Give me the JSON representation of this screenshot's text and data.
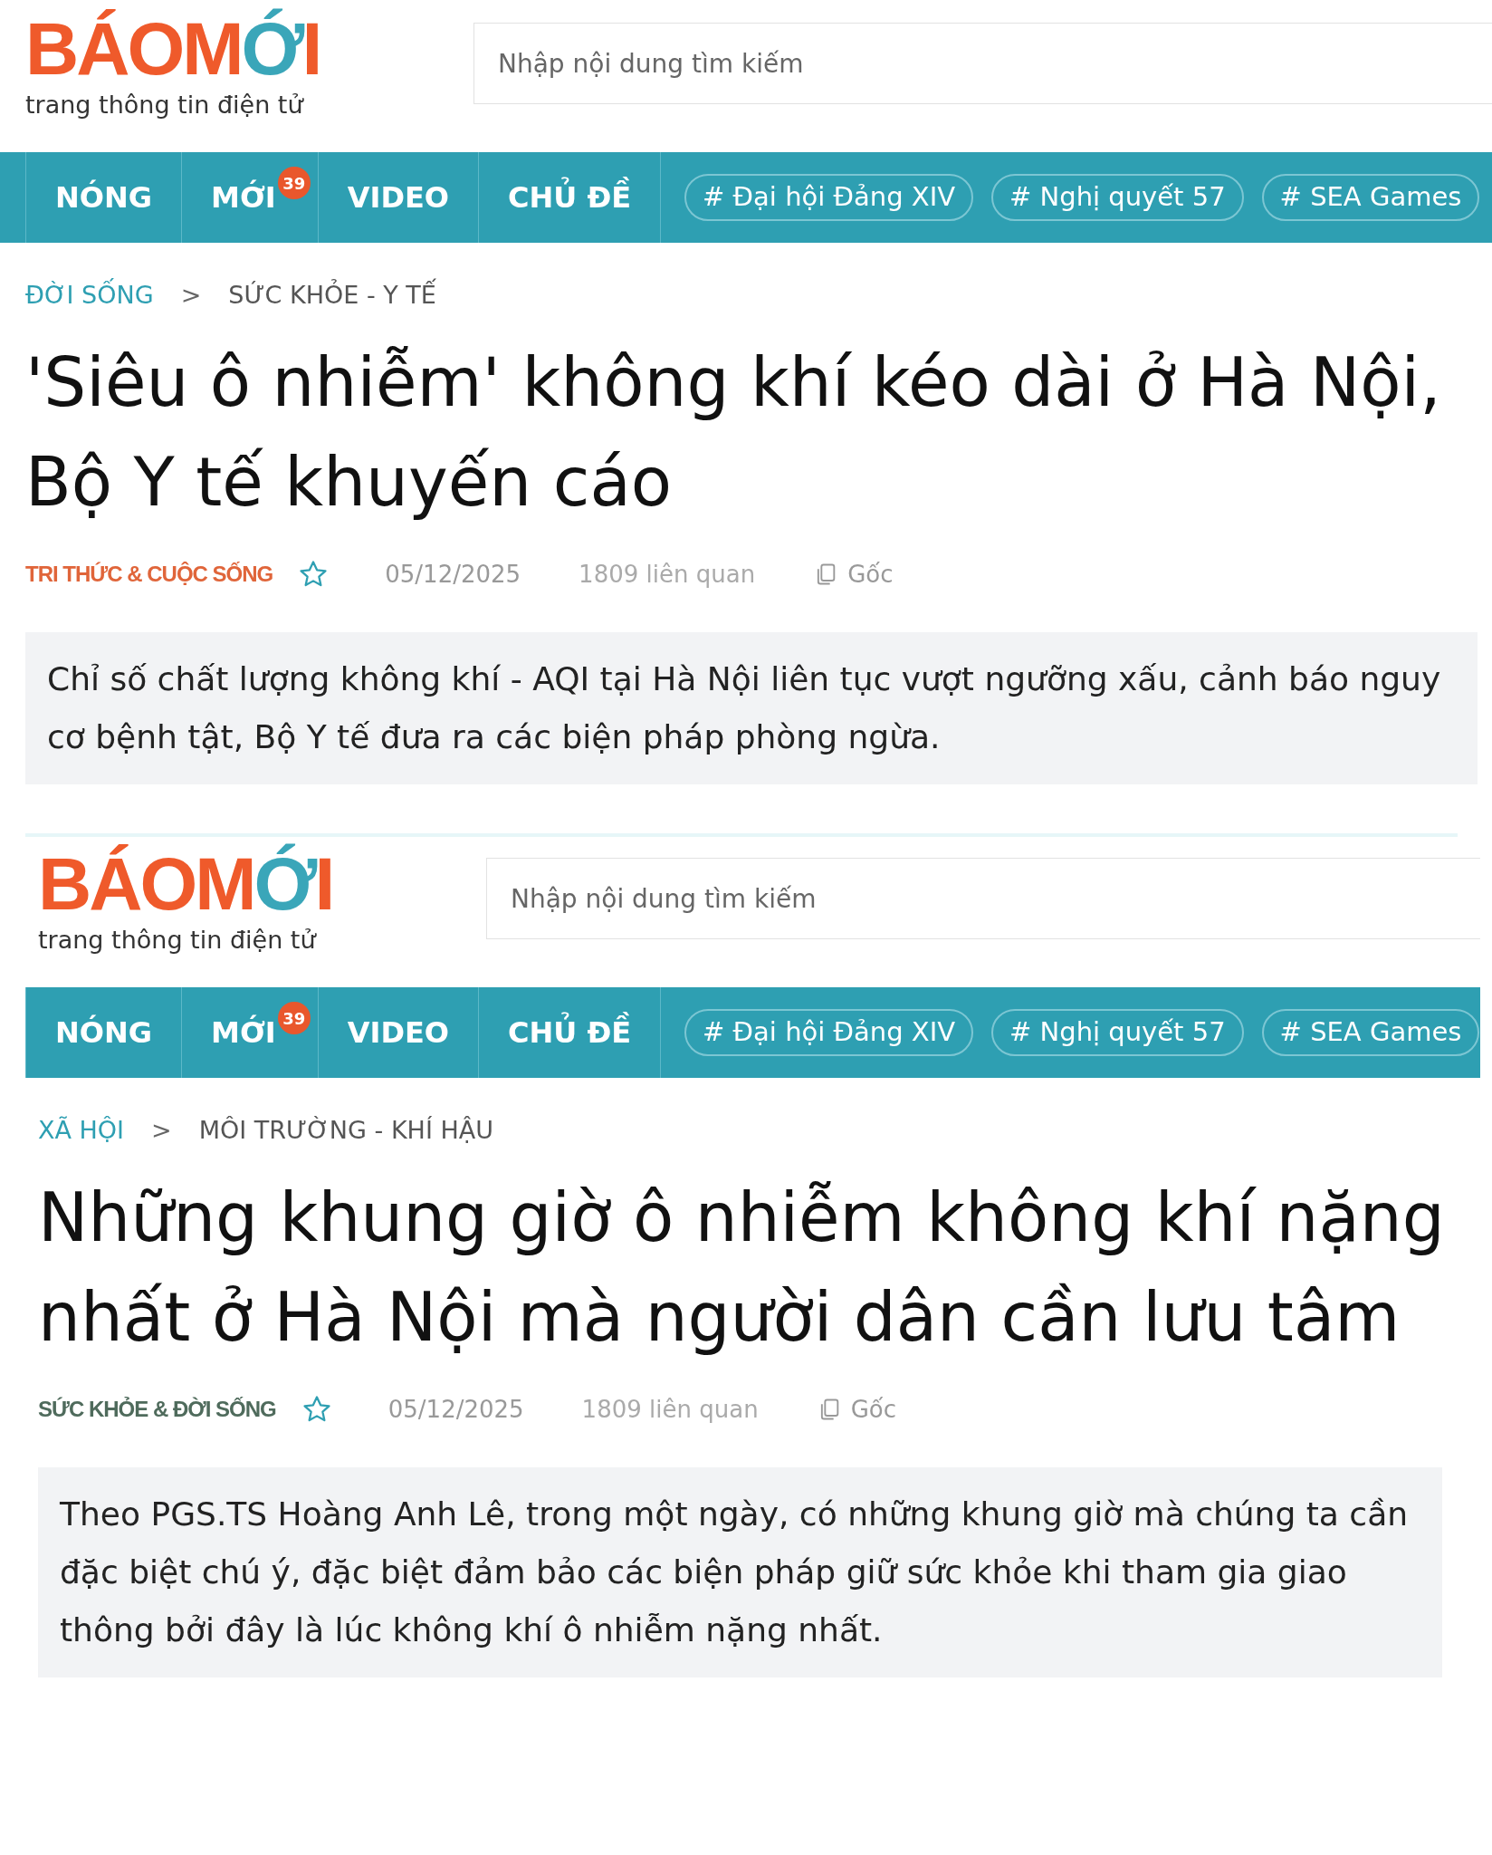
{
  "panels": [
    {
      "logo": {
        "wordmark_start": "BÁOM",
        "wordmark_accent": "Ớ",
        "wordmark_end": "I",
        "tagline": "trang thông tin điện tử"
      },
      "search": {
        "placeholder": "Nhập nội dung tìm kiếm"
      },
      "nav": [
        {
          "label": "NÓNG"
        },
        {
          "label": "MỚI",
          "badge": "39"
        },
        {
          "label": "VIDEO"
        },
        {
          "label": "CHỦ ĐỀ"
        }
      ],
      "topics": [
        "# Đại hội Đảng XIV",
        "# Nghị quyết 57",
        "# SEA Games"
      ],
      "breadcrumb": {
        "category": "ĐỜI SỐNG",
        "separator": ">",
        "subcategory": "SỨC KHỎE - Y TẾ"
      },
      "title": "'Siêu ô nhiễm' không khí kéo dài ở Hà Nội, Bộ Y tế khuyến cáo",
      "source": {
        "name": "TRI THỨC & CUỘC SỐNG",
        "color": "#e0653a"
      },
      "bookmarked": false,
      "date": "05/12/2025",
      "related": "1809 liên quan",
      "original": "Gốc",
      "summary": "Chỉ số chất lượng không khí - AQI tại Hà Nội liên tục vượt ngưỡng xấu, cảnh báo nguy cơ bệnh tật, Bộ Y tế đưa ra các biện pháp phòng ngừa."
    },
    {
      "logo": {
        "wordmark_start": "BÁOM",
        "wordmark_accent": "Ớ",
        "wordmark_end": "I",
        "tagline": "trang thông tin điện tử"
      },
      "search": {
        "placeholder": "Nhập nội dung tìm kiếm"
      },
      "nav": [
        {
          "label": "NÓNG"
        },
        {
          "label": "MỚI",
          "badge": "39"
        },
        {
          "label": "VIDEO"
        },
        {
          "label": "CHỦ ĐỀ"
        }
      ],
      "topics": [
        "# Đại hội Đảng XIV",
        "# Nghị quyết 57",
        "# SEA Games"
      ],
      "breadcrumb": {
        "category": "XÃ HỘI",
        "separator": ">",
        "subcategory": "MÔI TRƯỜNG - KHÍ HẬU"
      },
      "title": "Những khung giờ ô nhiễm không khí nặng nhất ở Hà Nội mà người dân cần lưu tâm",
      "source": {
        "name": "SỨC KHỎE & ĐỜI SỐNG",
        "color": "#4f6b5c"
      },
      "bookmarked": false,
      "date": "05/12/2025",
      "related": "1809 liên quan",
      "original": "Gốc",
      "summary": "Theo PGS.TS Hoàng Anh Lê, trong một ngày, có những khung giờ mà chúng ta cần đặc biệt chú ý, đặc biệt đảm bảo các biện pháp giữ sức khỏe khi tham gia giao thông bởi đây là lúc không khí ô nhiễm nặng nhất."
    }
  ]
}
